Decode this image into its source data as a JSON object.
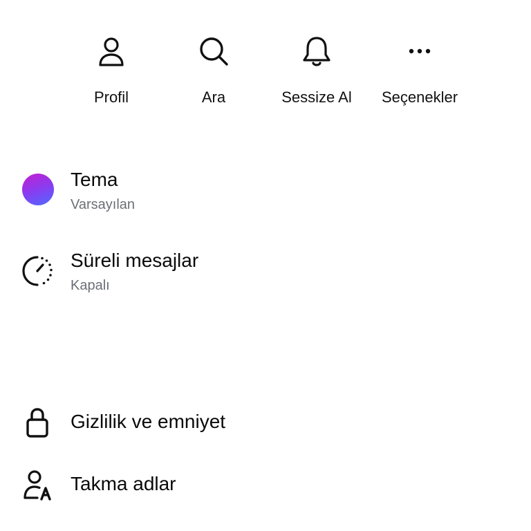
{
  "header": {
    "title": ""
  },
  "actions": [
    {
      "label": "Profil",
      "icon": "person-icon"
    },
    {
      "label": "Ara",
      "icon": "search-icon"
    },
    {
      "label": "Sessize Al",
      "icon": "bell-icon"
    },
    {
      "label": "Seçenekler",
      "icon": "more-horizontal-icon"
    }
  ],
  "settings": {
    "theme": {
      "title": "Tema",
      "subtitle": "Varsayılan",
      "colors": [
        "#c21fd0",
        "#4d6bff"
      ]
    },
    "disappearing": {
      "title": "Süreli mesajlar",
      "subtitle": "Kapalı",
      "icon": "timer-icon"
    },
    "privacy": {
      "title": "Gizlilik ve emniyet",
      "icon": "lock-icon"
    },
    "nicknames": {
      "title": "Takma adlar",
      "icon": "person-nickname-icon"
    }
  }
}
